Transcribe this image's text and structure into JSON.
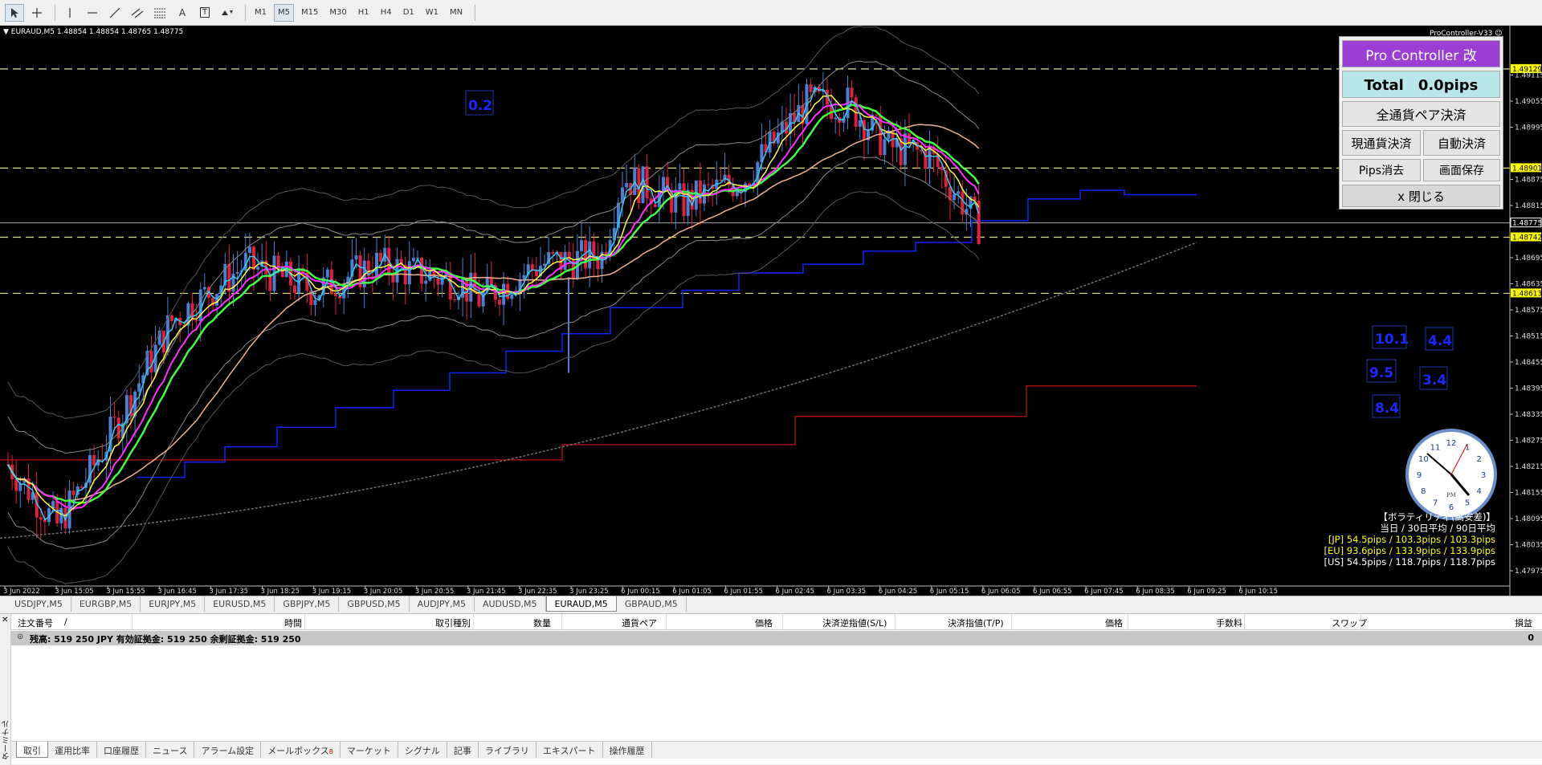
{
  "toolbar": {
    "tools": [
      "cursor-icon",
      "crosshair-icon",
      "vertical-line-icon",
      "horizontal-line-icon",
      "trendline-icon",
      "channel-icon",
      "fibonacci-icon",
      "text-icon",
      "text-label-icon",
      "arrows-icon"
    ],
    "text_tool": "A",
    "text_label_tool": "T",
    "timeframes": [
      "M1",
      "M5",
      "M15",
      "M30",
      "H1",
      "H4",
      "D1",
      "W1",
      "MN"
    ],
    "active_timeframe": "M5"
  },
  "chart": {
    "symbol_info": "EURAUD,M5  1.48854 1.48854 1.48765 1.48775",
    "ea_label": "ProController-V33 ☺",
    "price_levels": [
      "1.49129",
      "1.49115",
      "1.49055",
      "1.48995",
      "1.48901",
      "1.48875",
      "1.48815",
      "1.48775",
      "1.48742",
      "1.48695",
      "1.48635",
      "1.48613",
      "1.48575",
      "1.48515",
      "1.48455",
      "1.48395",
      "1.48335",
      "1.48275",
      "1.48215",
      "1.48155",
      "1.48095",
      "1.48035",
      "1.47975"
    ],
    "highlighted_levels": {
      "l1": "1.49129",
      "l2": "1.48901",
      "l3": "1.48742",
      "l4": "1.48613",
      "current": "1.48775"
    },
    "time_labels": [
      "3 Jun 2022",
      "3 Jun 15:05",
      "3 Jun 15:55",
      "3 Jun 16:45",
      "3 Jun 17:35",
      "3 Jun 18:25",
      "3 Jun 19:15",
      "3 Jun 20:05",
      "3 Jun 20:55",
      "3 Jun 21:45",
      "3 Jun 22:35",
      "3 Jun 23:25",
      "6 Jun 00:15",
      "6 Jun 01:05",
      "6 Jun 01:55",
      "6 Jun 02:45",
      "6 Jun 03:35",
      "6 Jun 04:25",
      "6 Jun 05:15",
      "6 Jun 06:05",
      "6 Jun 06:55",
      "6 Jun 07:45",
      "6 Jun 08:35",
      "6 Jun 09:25",
      "6 Jun 10:15"
    ],
    "spread_box": "0.2",
    "value_boxes": [
      "10.1",
      "4.4",
      "9.5",
      "3.4",
      "8.4"
    ],
    "clock": {
      "pm_label": "PM",
      "numbers": [
        "12",
        "1",
        "2",
        "3",
        "4",
        "5",
        "6",
        "7",
        "8",
        "9",
        "10",
        "11"
      ]
    },
    "volatility": {
      "title": "【ボラティリティ(高安差)】",
      "subtitle": "当日 / 30日平均 / 90日平均",
      "jp": "[JP] 54.5pips / 103.3pips / 103.3pips",
      "eu": "[EU] 93.6pips / 133.9pips / 133.9pips",
      "us": "[US] 54.5pips / 118.7pips / 118.7pips",
      "jp_color": "#ffff00",
      "eu_color": "#ffff00",
      "us_color": "#ffffff"
    }
  },
  "pro_controller": {
    "title": "Pro Controller 改",
    "total": "Total　0.0pips",
    "close_all": "全通貨ペア決済",
    "close_current": "現通貨決済",
    "auto_close": "自動決済",
    "clear_pips": "Pips消去",
    "save_screen": "画面保存",
    "close": "x 閉じる"
  },
  "symbol_tabs": [
    "USDJPY,M5",
    "EURGBP,M5",
    "EURJPY,M5",
    "EURUSD,M5",
    "GBPJPY,M5",
    "GBPUSD,M5",
    "AUDJPY,M5",
    "AUDUSD,M5",
    "EURAUD,M5",
    "GBPAUD,M5"
  ],
  "active_symbol_tab": "EURAUD,M5",
  "terminal": {
    "side_label": "ターミナル",
    "columns": [
      "注文番号",
      "/",
      "時間",
      "取引種別",
      "数量",
      "通貨ペア",
      "価格",
      "決済逆指値(S/L)",
      "決済指値(T/P)",
      "価格",
      "手数料",
      "スワップ",
      "損益"
    ],
    "balance_line": "残高: 519 250 JPY  有効証拠金: 519 250  余剰証拠金: 519 250",
    "balance_pl": "0",
    "tabs": [
      "取引",
      "運用比率",
      "口座履歴",
      "ニュース",
      "アラーム設定",
      "メールボックス",
      "マーケット",
      "シグナル",
      "記事",
      "ライブラリ",
      "エキスパート",
      "操作履歴"
    ],
    "mailbox_badge": "8",
    "active_tab": "取引"
  },
  "colors": {
    "chart_bg": "#000000",
    "bull_candle": "#4a7fd4",
    "bear_candle": "#e0203c",
    "ma_cyan": "#3cc8f0",
    "ma_yellow": "#ffff40",
    "ma_magenta": "#ff30ff",
    "ma_green": "#40ff40",
    "ma_salmon": "#f0b090",
    "step_blue": "#1020ff",
    "step_red": "#a01010",
    "trend_gray": "#707070",
    "level_line": "#e0e080",
    "pc_title_bg": "#9b3fd4",
    "pc_total_bg": "#b8e6ea"
  }
}
